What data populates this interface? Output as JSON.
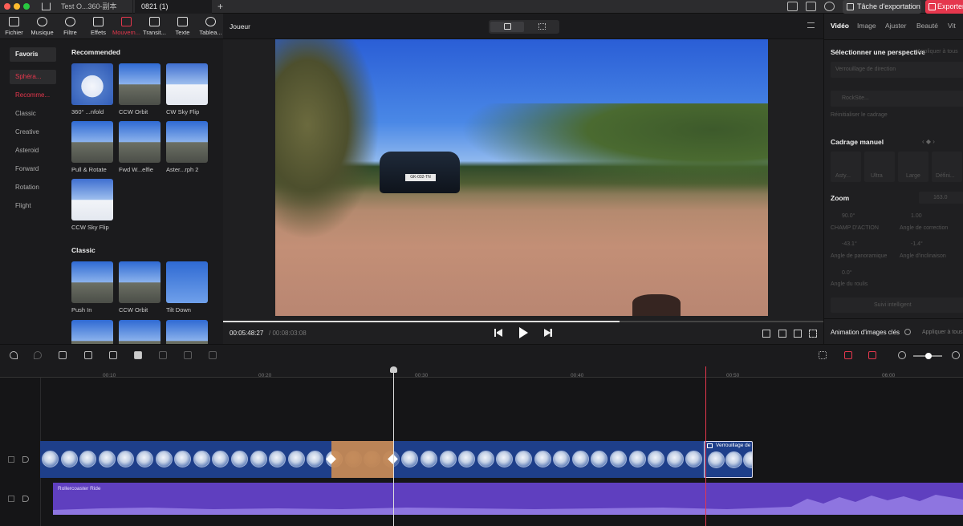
{
  "titlebar": {
    "tabs": [
      "Test O...360-副本",
      "0821 (1)"
    ],
    "export_task": "Tâche d'exportation",
    "export": "Exporter"
  },
  "toolbar": {
    "items": [
      "Fichier",
      "Musique",
      "Filtre",
      "Effets",
      "Mouvem...",
      "Transit...",
      "Texte",
      "Tablea..."
    ],
    "active_index": 4
  },
  "leftnav": {
    "items": [
      "Favoris",
      "Sphéra...",
      "Recomme...",
      "Classic",
      "Creative",
      "Asteroid",
      "Forward",
      "Rotation",
      "Flight"
    ]
  },
  "panel": {
    "recommended_title": "Recommended",
    "recommended": [
      "360° ...nfold",
      "CCW Orbit",
      "CW Sky Flip",
      "Pull & Rotate",
      "Fwd W...elfie",
      "Aster...rph 2",
      "CCW Sky Flip"
    ],
    "classic_title": "Classic",
    "classic": [
      "Push In",
      "CCW Orbit",
      "Tilt Down"
    ]
  },
  "player": {
    "title": "Joueur",
    "current_time": "00:05:48:27",
    "total_time": "/ 00:08:03:08",
    "progress": 0.66,
    "plate": "GK-032-TN"
  },
  "rightpanel": {
    "tabs": [
      "Vidéo",
      "Image",
      "Ajuster",
      "Beauté",
      "Vit"
    ],
    "perspective_title": "Sélectionner une perspective",
    "apply_all": "Appliquer à tous",
    "lock_direction": "Verrouillage de direction",
    "rocksite": "RockSite...",
    "reset": "Réinitialiser le cadrage",
    "crop_title": "Cadrage manuel",
    "crop_options": [
      "Asty...",
      "Ultra",
      "Large",
      "Défini..."
    ],
    "zoom_title": "Zoom",
    "zoom_value": "163.0",
    "params": [
      {
        "value": "90.0°",
        "label": "CHAMP D'ACTION"
      },
      {
        "value": "1.00",
        "label": "Angle de correction"
      },
      {
        "value": "-43.1°",
        "label": "Angle de panoramique"
      },
      {
        "value": "-1.4°",
        "label": "Angle d'inclinaison"
      },
      {
        "value": "0.0°",
        "label": "Angle du roulis"
      }
    ],
    "smart_follow": "Suivi intelligent",
    "keyframe_title": "Animation d'images clés",
    "keyframe_apply": "Appliquer à tous"
  },
  "ruler": {
    "ticks": [
      "00:10",
      "00:20",
      "00:30",
      "00:40",
      "00:50",
      "06:00"
    ]
  },
  "timeline": {
    "clip2_label": "Verrouillage de",
    "audio_label": "Rollercoaster Ride"
  },
  "colors": {
    "accent": "#e5374d",
    "video_track": "#1e3f8a",
    "audio_track": "#5f3fbf",
    "selected_clip": "#c98a52"
  }
}
